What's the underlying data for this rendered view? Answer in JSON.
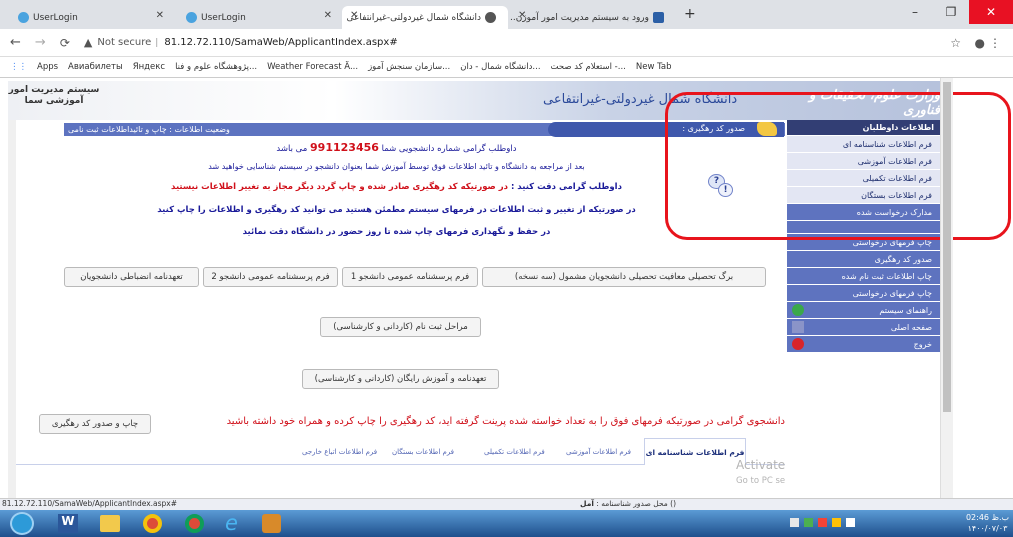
{
  "tabs": [
    {
      "title": "UserLogin"
    },
    {
      "title": "UserLogin"
    },
    {
      "title": "دانشگاه شمال غیردولتی-غیرانتفاعی"
    },
    {
      "title": "ورود به سیستم مدیریت امور آموزن..."
    }
  ],
  "address": {
    "security": "Not secure",
    "url": "81.12.72.110/SamaWeb/ApplicantIndex.aspx#"
  },
  "bookmarks": [
    "Apps",
    "Авиабилеты",
    "Яндекс",
    "پژوهشگاه علوم و فنا...",
    "Weather Forecast Ä...",
    "سازمان سنجش آموز...",
    "دانشگاه شمال - دان...",
    "استعلام کد صحت -...",
    "New Tab"
  ],
  "banner": {
    "brand_right": "وزارت علوم، تحقیقات و فناوری",
    "university": "دانشگاه شمال غیردولتی-غیرانتفاعی",
    "brand_left_1": "سیستم مدیریت امور",
    "brand_left_2": "آموزشی سما"
  },
  "section": {
    "status_label": "وضعیت اطلاعات : چاپ و تائیداطلاعات ثبت نامی",
    "tracking_label": "صدور کد رهگیری :"
  },
  "messages": {
    "line1_prefix": "داوطلب گرامی شماره دانشجویی شما",
    "student_number": "991123456",
    "line1_suffix": "می باشد",
    "line2": "بعد از مراجعه به دانشگاه و تائید اطلاعات فوق توسط آموزش شما بعنوان دانشجو در سیستم شناسایی خواهید شد",
    "line3_prefix": "داوطلب گرامی دقت کنید :",
    "line3_rest": "در صورتیکه کد رهگیری صادر شده و چاپ گردد دیگر مجاز به تغییر اطلاعات نیستید",
    "line4": "در صورتیکه از تغییر و ثبت اطلاعات در فرمهای سیستم مطمئن هستید می توانید کد رهگیری و اطلاعات را چاپ کنید",
    "line5": "در حفظ و نگهداری فرمهای چاپ شده تا روز حضور در دانشگاه دقت نمائید",
    "bottom_notice": "دانشجوی گرامی در صورتیکه فرمهای فوق را به تعداد خواسته شده پرینت گرفته اید، کد رهگیری را چاپ کرده و همراه خود داشته باشید"
  },
  "buttons": {
    "form1": "برگ تحصیلی معافیت تحصیلی دانشجویان مشمول (سه نسخه)",
    "form2": "فرم پرسشنامه عمومی دانشجو 1",
    "form3": "فرم پرسشنامه عمومی دانشجو 2",
    "form4": "تعهدنامه انضباطی دانشجویان",
    "reg_steps": "مراحل ثبت نام (کاردانی و کارشناسی)",
    "free_edu": "تعهدنامه و آموزش رایگان (کاردانی و کارشناسی)",
    "print_code": "چاپ و صدور کد رهگیری"
  },
  "bottom_tabs": [
    "فرم اطلاعات شناسنامه ای",
    "فرم اطلاعات آموزشی",
    "فرم اطلاعات تکمیلی",
    "فرم اطلاعات بستگان",
    "فرم اطلاعات اتباع خارجی"
  ],
  "sidebar": {
    "header": "اطلاعات داوطلبان",
    "items": [
      "فرم اطلاعات شناسنامه ای",
      "فرم اطلاعات آموزشی",
      "فرم اطلاعات تکمیلی",
      "فرم اطلاعات بستگان",
      "مدارک درخواست شده"
    ],
    "items2": [
      "چاپ فرمهای درخواستی",
      "صدور کد رهگیری",
      "چاپ اطلاعات ثبت نام شده",
      "چاپ فرمهای درخواستی",
      "راهنمای سیستم",
      "صفحه اصلی",
      "خروج"
    ]
  },
  "watermark": {
    "line1": "Activate Windows",
    "line2": "Go to PC settings to activate Windows."
  },
  "status_url": "81.12.72.110/SamaWeb/ApplicantIndex.aspx#",
  "footer": {
    "birthplace": "() محل صدور شناسنامه :",
    "birthplace_val": "آمل"
  },
  "clock": {
    "time": "02:46",
    "ampm": "ب.ظ",
    "date": "۱۴۰۰/۰۷/۰۳"
  },
  "highlight_color": "#e8141c"
}
